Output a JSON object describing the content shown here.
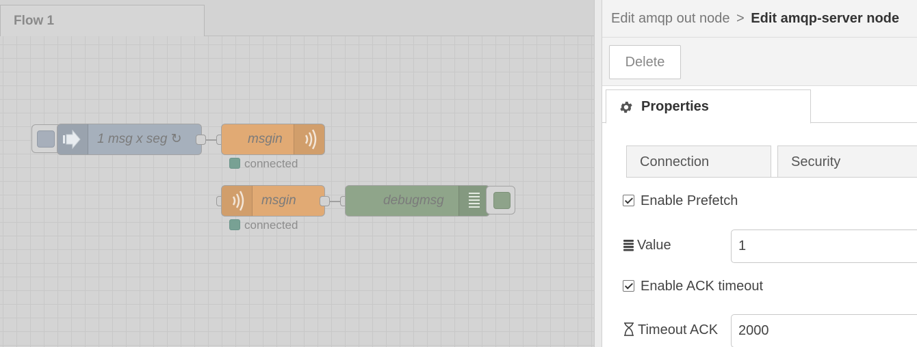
{
  "workspace": {
    "flow_tab": "Flow 1",
    "nodes": {
      "inject": {
        "label": "1 msg x seg ↻"
      },
      "msgin_top": {
        "label": "msgin",
        "status": "connected"
      },
      "msgin_bottom": {
        "label": "msgin",
        "status": "connected"
      },
      "debug": {
        "label": "debugmsg"
      }
    }
  },
  "tray": {
    "breadcrumb_parent": "Edit amqp out node",
    "breadcrumb_sep": ">",
    "breadcrumb_current": "Edit amqp-server node",
    "delete_label": "Delete",
    "properties_tab": "Properties",
    "subtabs": {
      "connection": "Connection",
      "security": "Security"
    },
    "enable_prefetch": "Enable Prefetch",
    "value_label": "Value",
    "value": "1",
    "enable_ack_timeout": "Enable ACK timeout",
    "timeout_label": "Timeout ACK",
    "timeout_value": "2000"
  },
  "colors": {
    "inject_node": "#a6b0bc",
    "amqp_node": "#e1aa74",
    "debug_node": "#8fa58a",
    "status_dot": "#78a194"
  },
  "icons": [
    "arrow-right-icon",
    "refresh-icon",
    "wifi-waves-icon",
    "list-icon",
    "gear-icon",
    "database-icon",
    "hourglass-icon",
    "checkbox-icon"
  ]
}
